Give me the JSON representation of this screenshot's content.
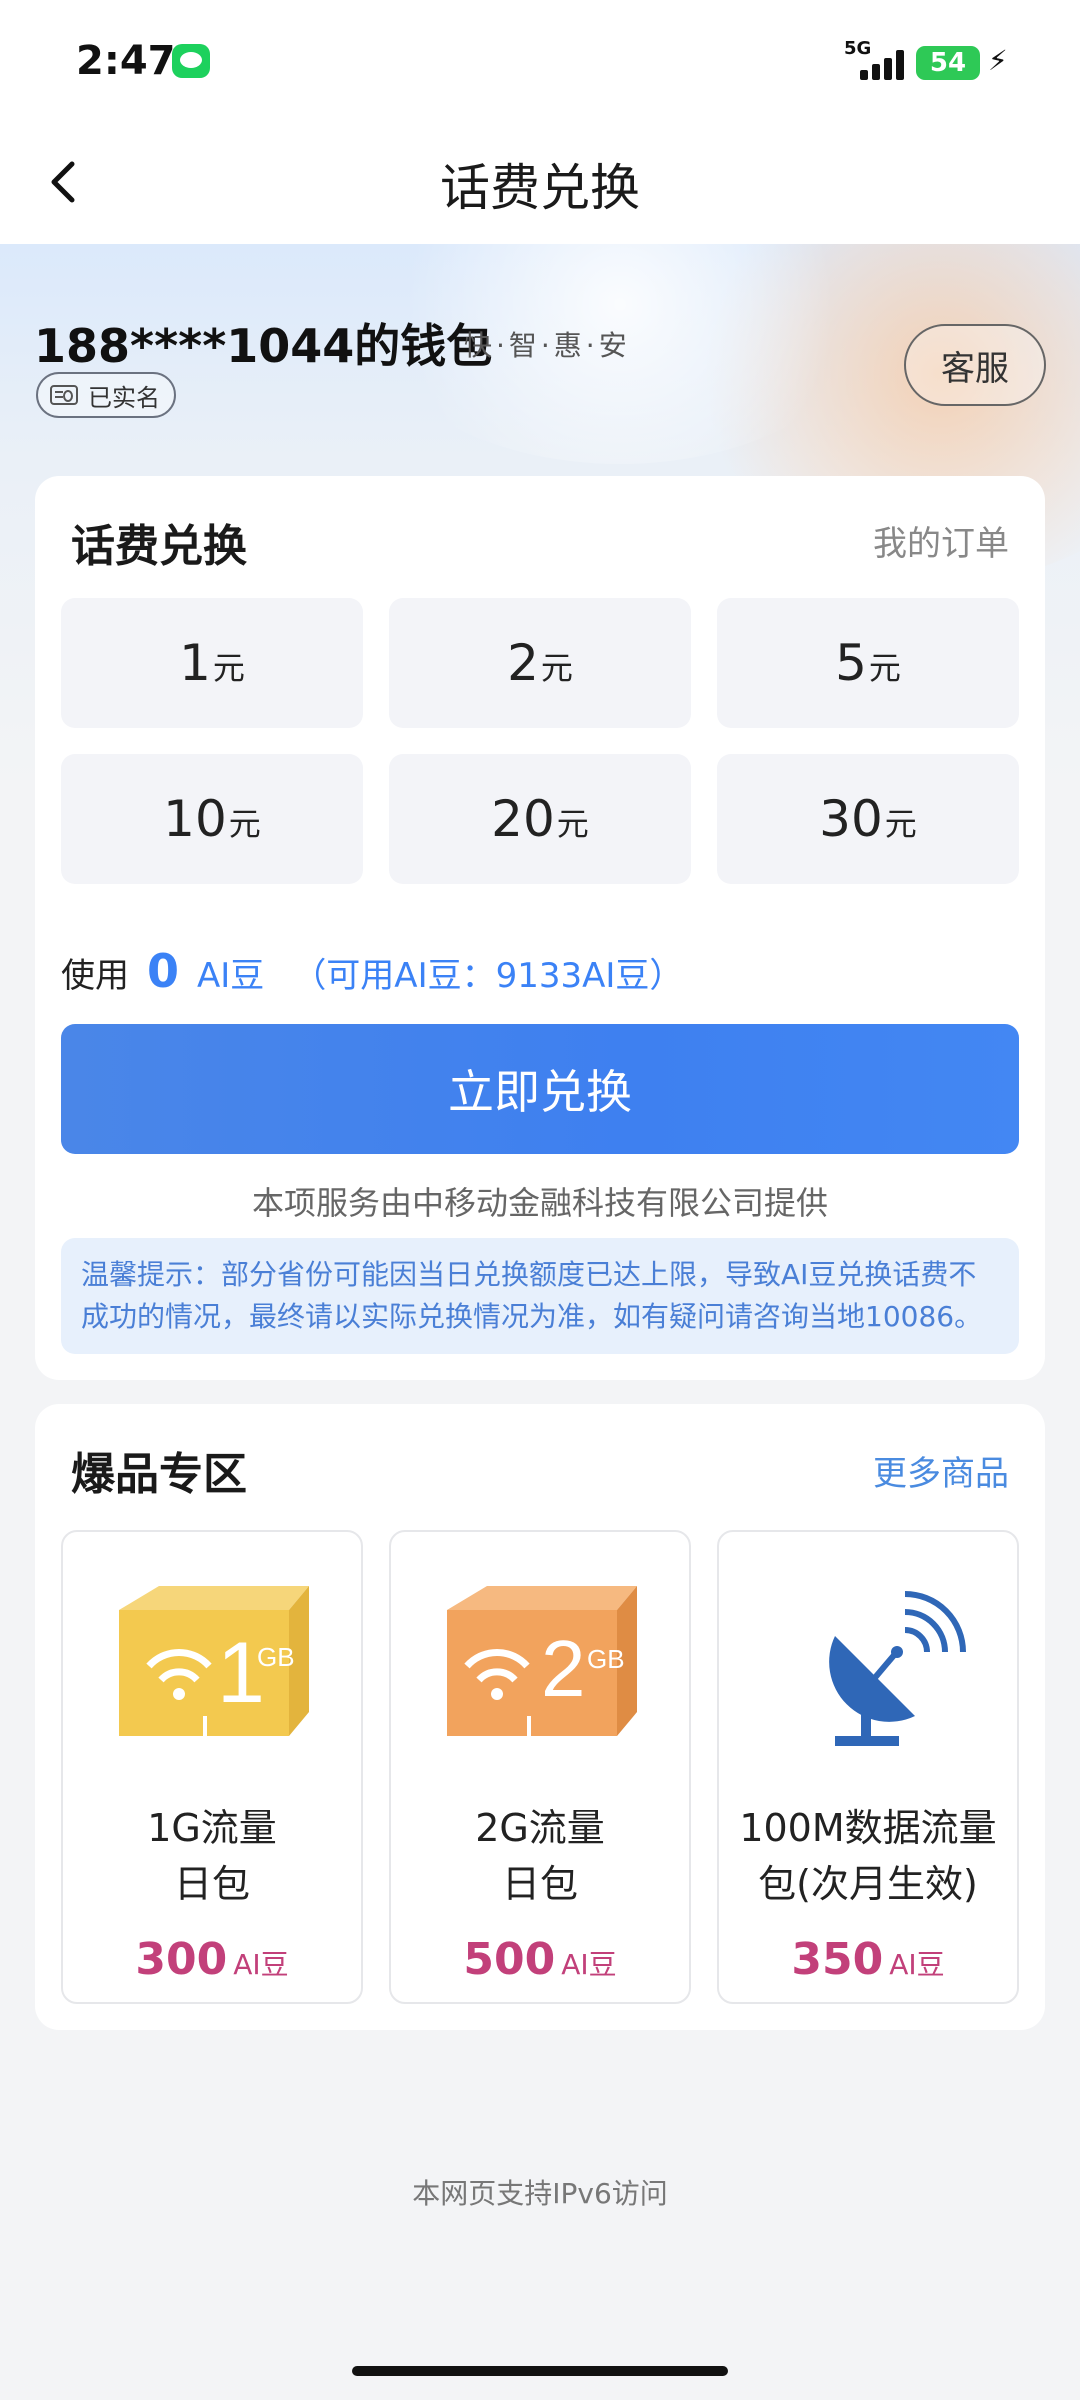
{
  "status_bar": {
    "time": "2:47",
    "network": "5G",
    "battery": "54"
  },
  "header": {
    "title": "话费兑换"
  },
  "wallet": {
    "title": "188****1044的钱包",
    "slogan": "快·智·惠·安",
    "verified_label": "已实名",
    "service_label": "客服"
  },
  "exchange": {
    "title": "话费兑换",
    "orders_link": "我的订单",
    "denominations": [
      {
        "value": "1",
        "unit": "元"
      },
      {
        "value": "2",
        "unit": "元"
      },
      {
        "value": "5",
        "unit": "元"
      },
      {
        "value": "10",
        "unit": "元"
      },
      {
        "value": "20",
        "unit": "元"
      },
      {
        "value": "30",
        "unit": "元"
      }
    ],
    "use_label": "使用",
    "use_amount": "0",
    "use_unit": "AI豆",
    "available_text": "（可用AI豆：9133AI豆）",
    "redeem_button": "立即兑换",
    "provider_text": "本项服务由中移动金融科技有限公司提供",
    "tip_text": "温馨提示：部分省份可能因当日兑换额度已达上限，导致AI豆兑换话费不成功的情况，最终请以实际兑换情况为准，如有疑问请咨询当地10086。"
  },
  "hot": {
    "title": "爆品专区",
    "more_link": "更多商品",
    "products": [
      {
        "name_line1": "1G流量",
        "name_line2": "日包",
        "price": "300",
        "unit": "AI豆",
        "image_text": "1",
        "image_sub": "GB",
        "icon": "data-box-1gb-icon"
      },
      {
        "name_line1": "2G流量",
        "name_line2": "日包",
        "price": "500",
        "unit": "AI豆",
        "image_text": "2",
        "image_sub": "GB",
        "icon": "data-box-2gb-icon"
      },
      {
        "name_line1": "100M数据流量",
        "name_line2": "包(次月生效)",
        "price": "350",
        "unit": "AI豆",
        "icon": "satellite-dish-icon"
      }
    ]
  },
  "footer": {
    "note": "本网页支持IPv6访问"
  },
  "colors": {
    "accent": "#3e80f0",
    "price": "#c2407a",
    "link": "#4a8be0"
  }
}
